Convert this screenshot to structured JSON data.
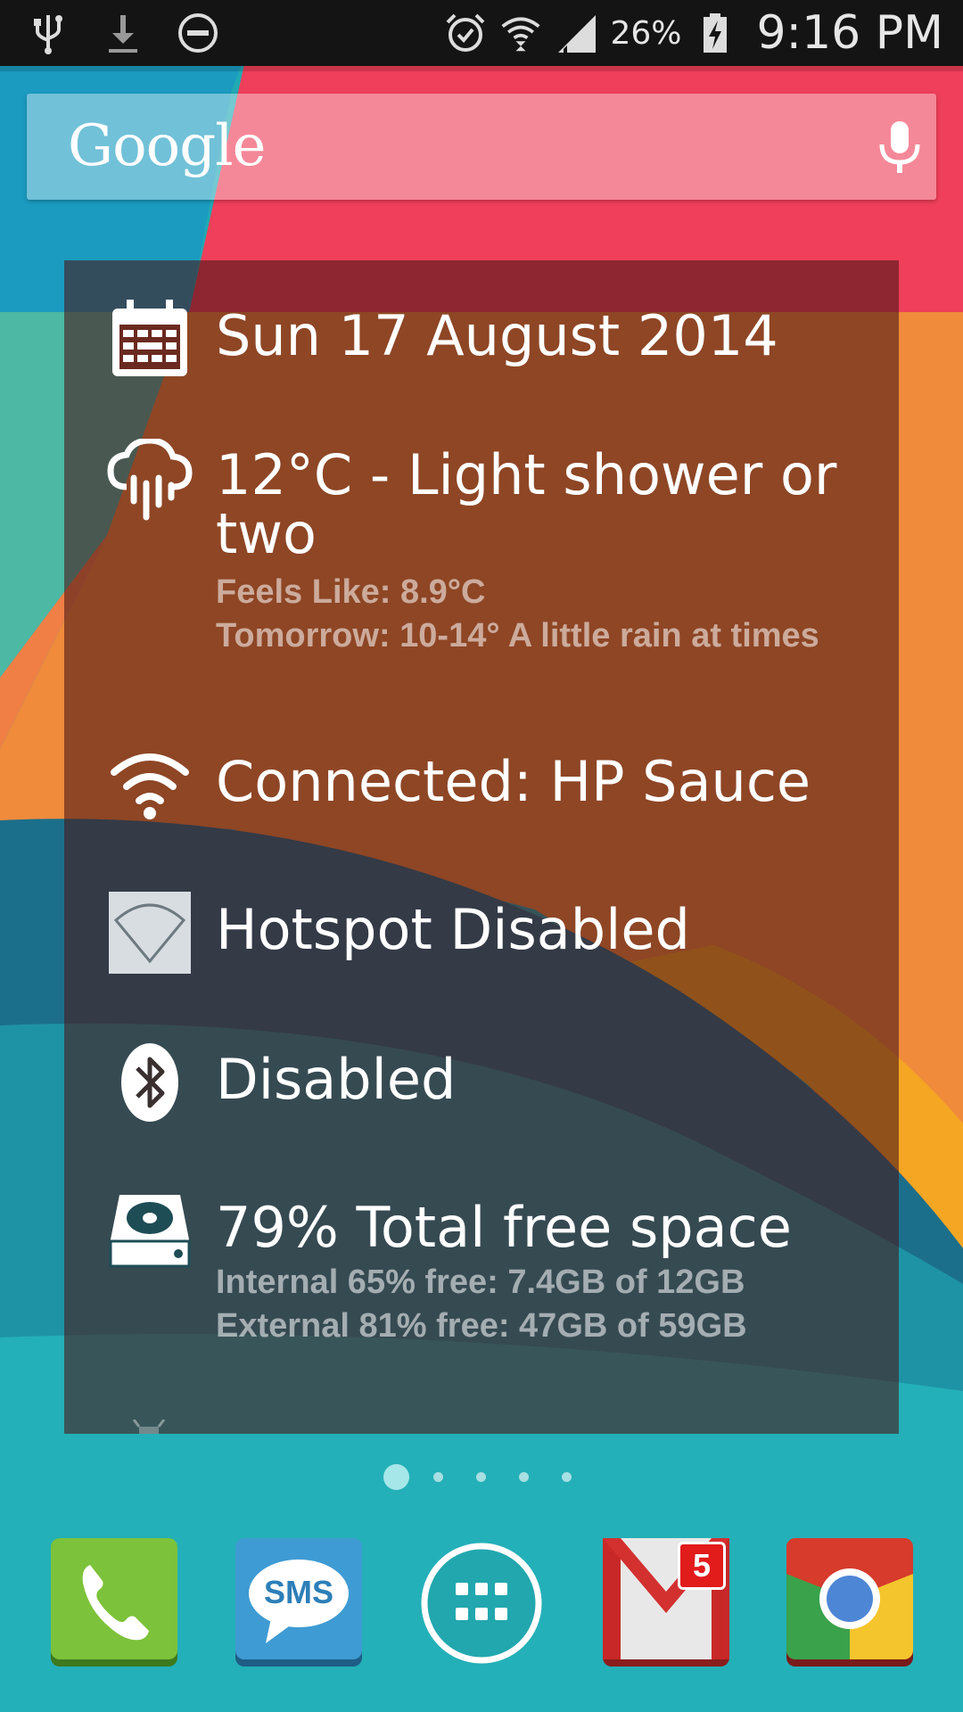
{
  "status_bar": {
    "battery_percent": "26%",
    "time": "9:16 PM",
    "left_icons": [
      "usb-icon",
      "download-icon",
      "do-not-disturb-icon"
    ],
    "right_icons": [
      "alarm-icon",
      "wifi-icon",
      "signal-icon",
      "battery-charging-icon"
    ]
  },
  "search": {
    "logo_text": "Google",
    "mic_icon": "microphone-icon"
  },
  "widget": {
    "date": {
      "icon": "calendar-icon",
      "text": "Sun 17 August 2014"
    },
    "weather": {
      "icon": "rain-cloud-icon",
      "line1": "12°C - Light shower or",
      "line2": "two",
      "feels_like": "Feels Like: 8.9°C",
      "tomorrow": "Tomorrow: 10-14° A little rain at times"
    },
    "wifi": {
      "icon": "wifi-icon",
      "text": "Connected: HP Sauce"
    },
    "hotspot": {
      "icon": "hotspot-icon",
      "text": "Hotspot Disabled"
    },
    "bluetooth": {
      "icon": "bluetooth-icon",
      "text": "Disabled"
    },
    "storage": {
      "icon": "hard-drive-icon",
      "text": "79% Total free space",
      "internal": "Internal 65% free: 7.4GB of 12GB",
      "external": "External 81% free: 47GB of 59GB"
    }
  },
  "page_indicator": {
    "pages": 5,
    "current": 1
  },
  "dock": {
    "items": [
      {
        "name": "Phone",
        "icon": "phone-icon"
      },
      {
        "name": "Messages",
        "icon": "sms-icon",
        "label": "SMS"
      },
      {
        "name": "Apps",
        "icon": "app-drawer-icon"
      },
      {
        "name": "Gmail",
        "icon": "gmail-icon",
        "badge": "5"
      },
      {
        "name": "Chrome",
        "icon": "chrome-icon"
      }
    ]
  },
  "colors": {
    "status_bar_bg": "#141414",
    "widget_bg": "rgba(70,20,20,0.58)",
    "badge_red": "#e21b1b"
  }
}
